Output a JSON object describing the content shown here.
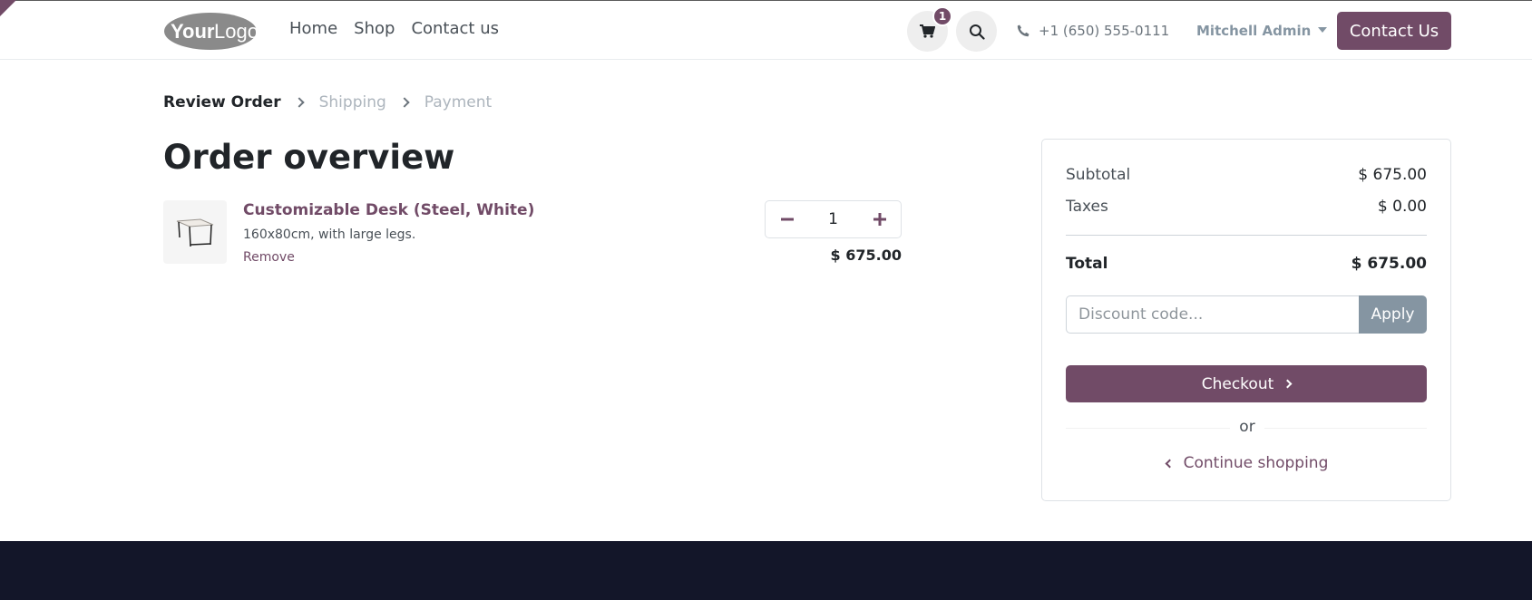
{
  "header": {
    "nav": [
      "Home",
      "Shop",
      "Contact us"
    ],
    "cart_count": "1",
    "phone": "+1 (650) 555-0111",
    "user": "Mitchell Admin",
    "contact_button": "Contact Us"
  },
  "steps": {
    "review": "Review Order",
    "shipping": "Shipping",
    "payment": "Payment"
  },
  "page_title": "Order overview",
  "line": {
    "name": "Customizable Desk (Steel, White)",
    "description": "160x80cm, with large legs.",
    "remove": "Remove",
    "quantity": "1",
    "price": "$ 675.00"
  },
  "summary": {
    "subtotal_label": "Subtotal",
    "subtotal": "$ 675.00",
    "taxes_label": "Taxes",
    "taxes": "$ 0.00",
    "total_label": "Total",
    "total": "$ 675.00",
    "discount_placeholder": "Discount code...",
    "apply": "Apply",
    "checkout": "Checkout",
    "or": "or",
    "continue": "Continue shopping"
  },
  "colors": {
    "brand": "#714B67",
    "secondary": "#8595a2",
    "footer": "#131629"
  }
}
